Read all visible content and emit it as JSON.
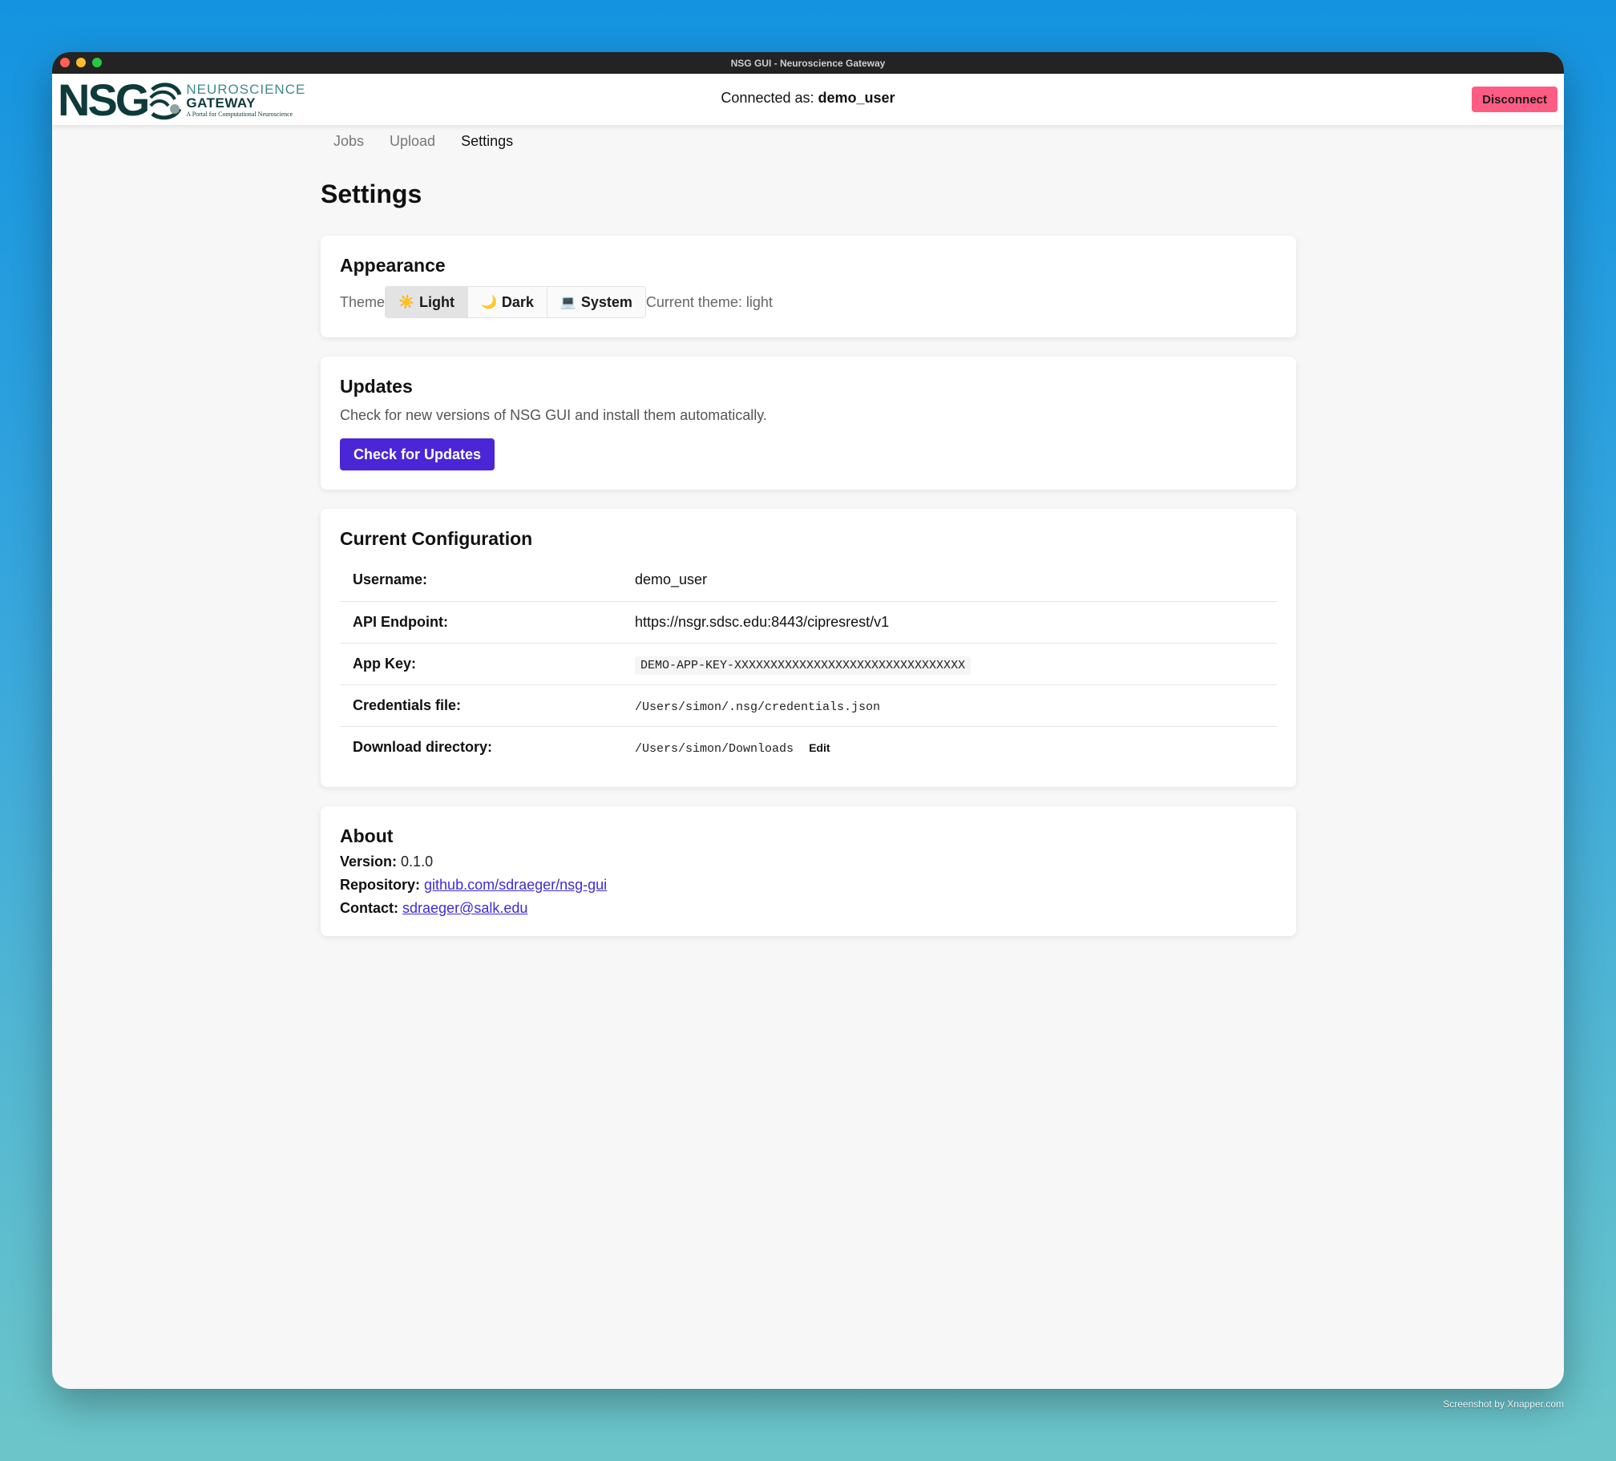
{
  "window": {
    "title": "NSG GUI - Neuroscience Gateway"
  },
  "logo": {
    "mark": "NSG",
    "line1": "NEUROSCIENCE",
    "line2": "GATEWAY",
    "tagline": "A Portal for Computational Neuroscience"
  },
  "header": {
    "connected_prefix": "Connected as:",
    "username": "demo_user",
    "disconnect_label": "Disconnect"
  },
  "nav": {
    "tabs": [
      {
        "label": "Jobs"
      },
      {
        "label": "Upload"
      },
      {
        "label": "Settings"
      }
    ],
    "active": "Settings"
  },
  "page": {
    "title": "Settings"
  },
  "appearance": {
    "title": "Appearance",
    "theme_label": "Theme",
    "options": [
      {
        "label": "Light",
        "icon": "sun-icon",
        "glyph": "☀️"
      },
      {
        "label": "Dark",
        "icon": "moon-icon",
        "glyph": "🌙"
      },
      {
        "label": "System",
        "icon": "computer-icon",
        "glyph": "💻"
      }
    ],
    "selected": "Light",
    "current_theme": "Current theme: light"
  },
  "updates": {
    "title": "Updates",
    "description": "Check for new versions of NSG GUI and install them automatically.",
    "button_label": "Check for Updates"
  },
  "config": {
    "title": "Current Configuration",
    "rows": [
      {
        "key": "Username:",
        "value": "demo_user"
      },
      {
        "key": "API Endpoint:",
        "value": "https://nsgr.sdsc.edu:8443/cipresrest/v1"
      },
      {
        "key": "App Key:",
        "value": "DEMO-APP-KEY-XXXXXXXXXXXXXXXXXXXXXXXXXXXXXXXX"
      },
      {
        "key": "Credentials file:",
        "value": "/Users/simon/.nsg/credentials.json"
      },
      {
        "key": "Download directory:",
        "value": "/Users/simon/Downloads",
        "action": "Edit"
      }
    ]
  },
  "about": {
    "title": "About",
    "version_label": "Version:",
    "version": "0.1.0",
    "repo_label": "Repository:",
    "repo": "github.com/sdraeger/nsg-gui",
    "contact_label": "Contact:",
    "contact": "sdraeger@salk.edu"
  },
  "watermark": "Screenshot by Xnapper.com",
  "colors": {
    "accent": "#4a26d6",
    "danger": "#ff5c84",
    "brand": "#0e3b3a"
  }
}
